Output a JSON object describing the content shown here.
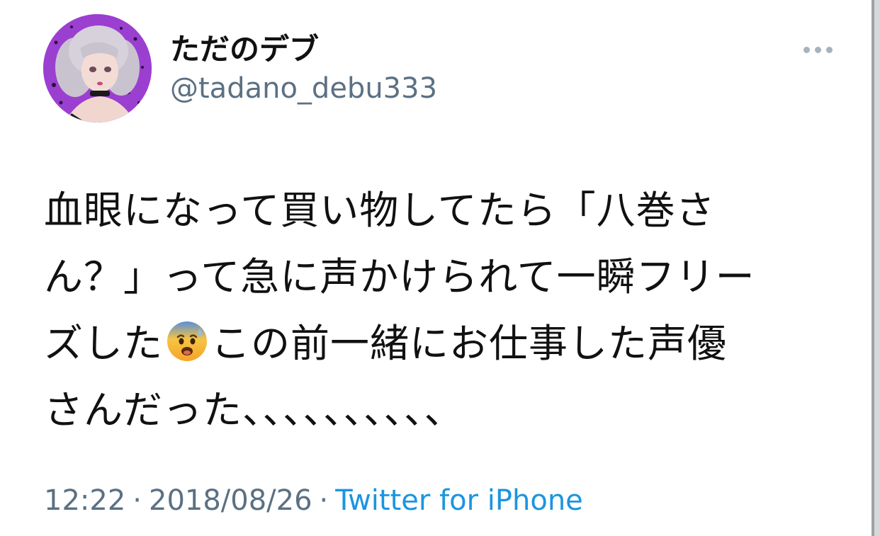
{
  "user": {
    "display_name": "ただのデブ",
    "handle": "@tadano_debu333",
    "avatar_icon": "profile-avatar"
  },
  "menu": {
    "more_icon": "more-options-icon"
  },
  "tweet": {
    "lines": [
      "血眼になって買い物してたら「八巻さ",
      "ん？」って急に声かけられて一瞬フリー",
      "ズした",
      "この前一緒にお仕事した声優",
      "さんだった、、、、、、、、、、"
    ],
    "emoji": "anxious-face-with-sweat-icon"
  },
  "meta": {
    "time": "12:22",
    "separator": "·",
    "date": "2018/08/26",
    "source": "Twitter for iPhone"
  },
  "colors": {
    "name": "#111111",
    "secondary": "#5b7083",
    "link": "#1b95e0",
    "avatar_bg": "#9b3fd1"
  }
}
